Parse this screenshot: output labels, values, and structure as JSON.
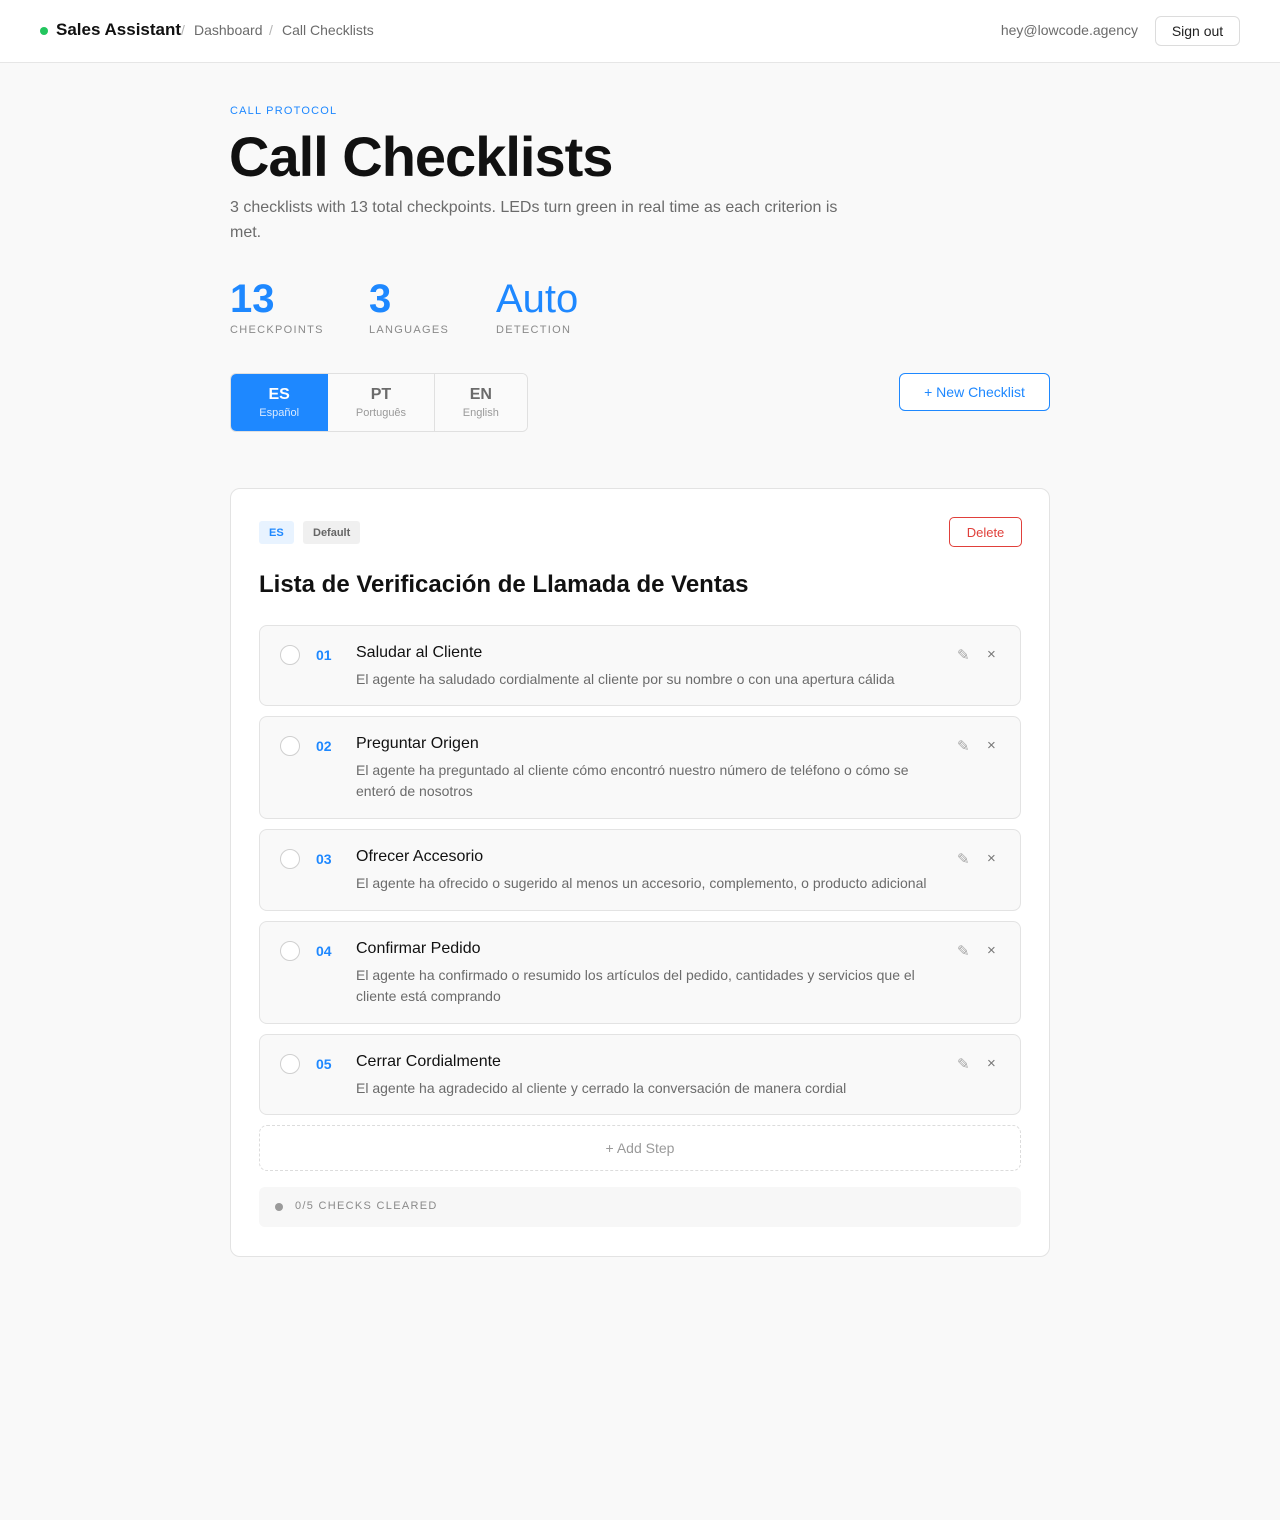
{
  "app": {
    "name": "Sales Assistant",
    "status_color": "#22c55e",
    "accent_color": "#1e88ff"
  },
  "breadcrumb": {
    "separator": "/",
    "items": [
      "Dashboard",
      "Call Checklists"
    ]
  },
  "user": {
    "email": "hey@lowcode.agency",
    "sign_out_label": "Sign out"
  },
  "header": {
    "eyebrow": "CALL PROTOCOL",
    "title": "Call Checklists",
    "subtitle": "3 checklists with 13 total checkpoints. LEDs turn green in real time as each criterion is met."
  },
  "stats": [
    {
      "value": "13",
      "label": "CHECKPOINTS"
    },
    {
      "value": "3",
      "label": "LANGUAGES"
    },
    {
      "value": "Auto",
      "label": "DETECTION"
    }
  ],
  "languages": [
    {
      "code": "ES",
      "name": "Español",
      "active": true
    },
    {
      "code": "PT",
      "name": "Português",
      "active": false
    },
    {
      "code": "EN",
      "name": "English",
      "active": false
    }
  ],
  "new_checklist_label": "+ New Checklist",
  "checklist": {
    "language_badge": "ES",
    "default_badge": "Default",
    "delete_label": "Delete",
    "title": "Lista de Verificación de Llamada de Ventas",
    "steps": [
      {
        "number": "01",
        "title": "Saludar al Cliente",
        "description": "El agente ha saludado cordialmente al cliente por su nombre o con una apertura cálida"
      },
      {
        "number": "02",
        "title": "Preguntar Origen",
        "description": "El agente ha preguntado al cliente cómo encontró nuestro número de teléfono o cómo se enteró de nosotros"
      },
      {
        "number": "03",
        "title": "Ofrecer Accesorio",
        "description": "El agente ha ofrecido o sugerido al menos un accesorio, complemento, o producto adicional"
      },
      {
        "number": "04",
        "title": "Confirmar Pedido",
        "description": "El agente ha confirmado o resumido los artículos del pedido, cantidades y servicios que el cliente está comprando"
      },
      {
        "number": "05",
        "title": "Cerrar Cordialmente",
        "description": "El agente ha agradecido al cliente y cerrado la conversación de manera cordial"
      }
    ],
    "edit_icon": "✎",
    "remove_icon": "×",
    "add_step_label": "+ Add Step",
    "progress_text": "0/5 CHECKS CLEARED",
    "checks_cleared": 0,
    "checks_total": 5
  }
}
